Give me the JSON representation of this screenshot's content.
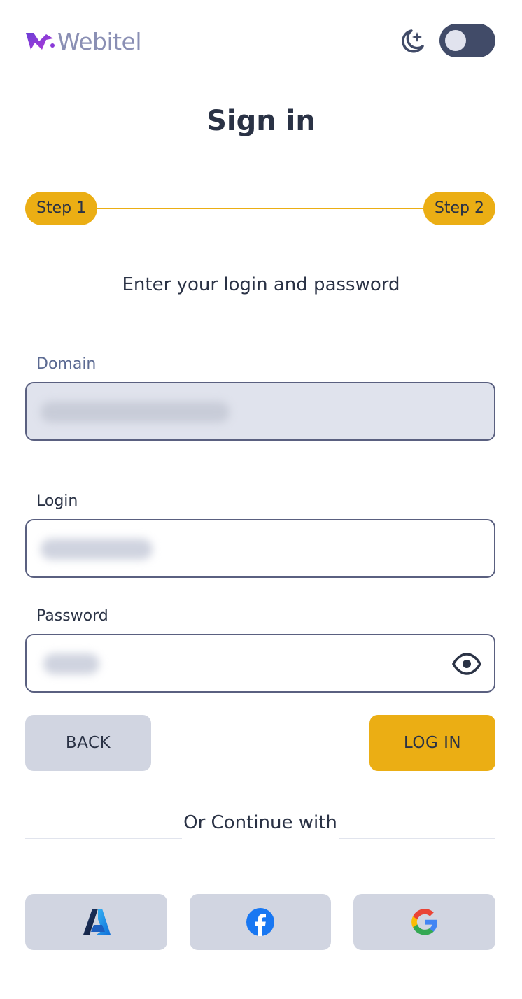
{
  "header": {
    "logo_text": "Webitel",
    "theme_icon": "moon-stars-icon",
    "theme_toggle_state": "off"
  },
  "title": "Sign in",
  "stepper": {
    "step1": "Step 1",
    "step2": "Step 2",
    "active_step": 2
  },
  "subtitle": "Enter your login and password",
  "form": {
    "domain_label": "Domain",
    "login_label": "Login",
    "password_label": "Password",
    "password_toggle_icon": "eye-icon"
  },
  "buttons": {
    "back": "BACK",
    "login": "LOG IN"
  },
  "divider_text": "Or Continue with",
  "social": [
    {
      "name": "azure",
      "icon": "azure-icon"
    },
    {
      "name": "facebook",
      "icon": "facebook-icon"
    },
    {
      "name": "google",
      "icon": "google-icon"
    }
  ],
  "colors": {
    "accent": "#ebae14",
    "text": "#2a3245",
    "button_secondary": "#d1d5e1",
    "toggle_bg": "#414b68",
    "logo": "#8a8fb4"
  }
}
